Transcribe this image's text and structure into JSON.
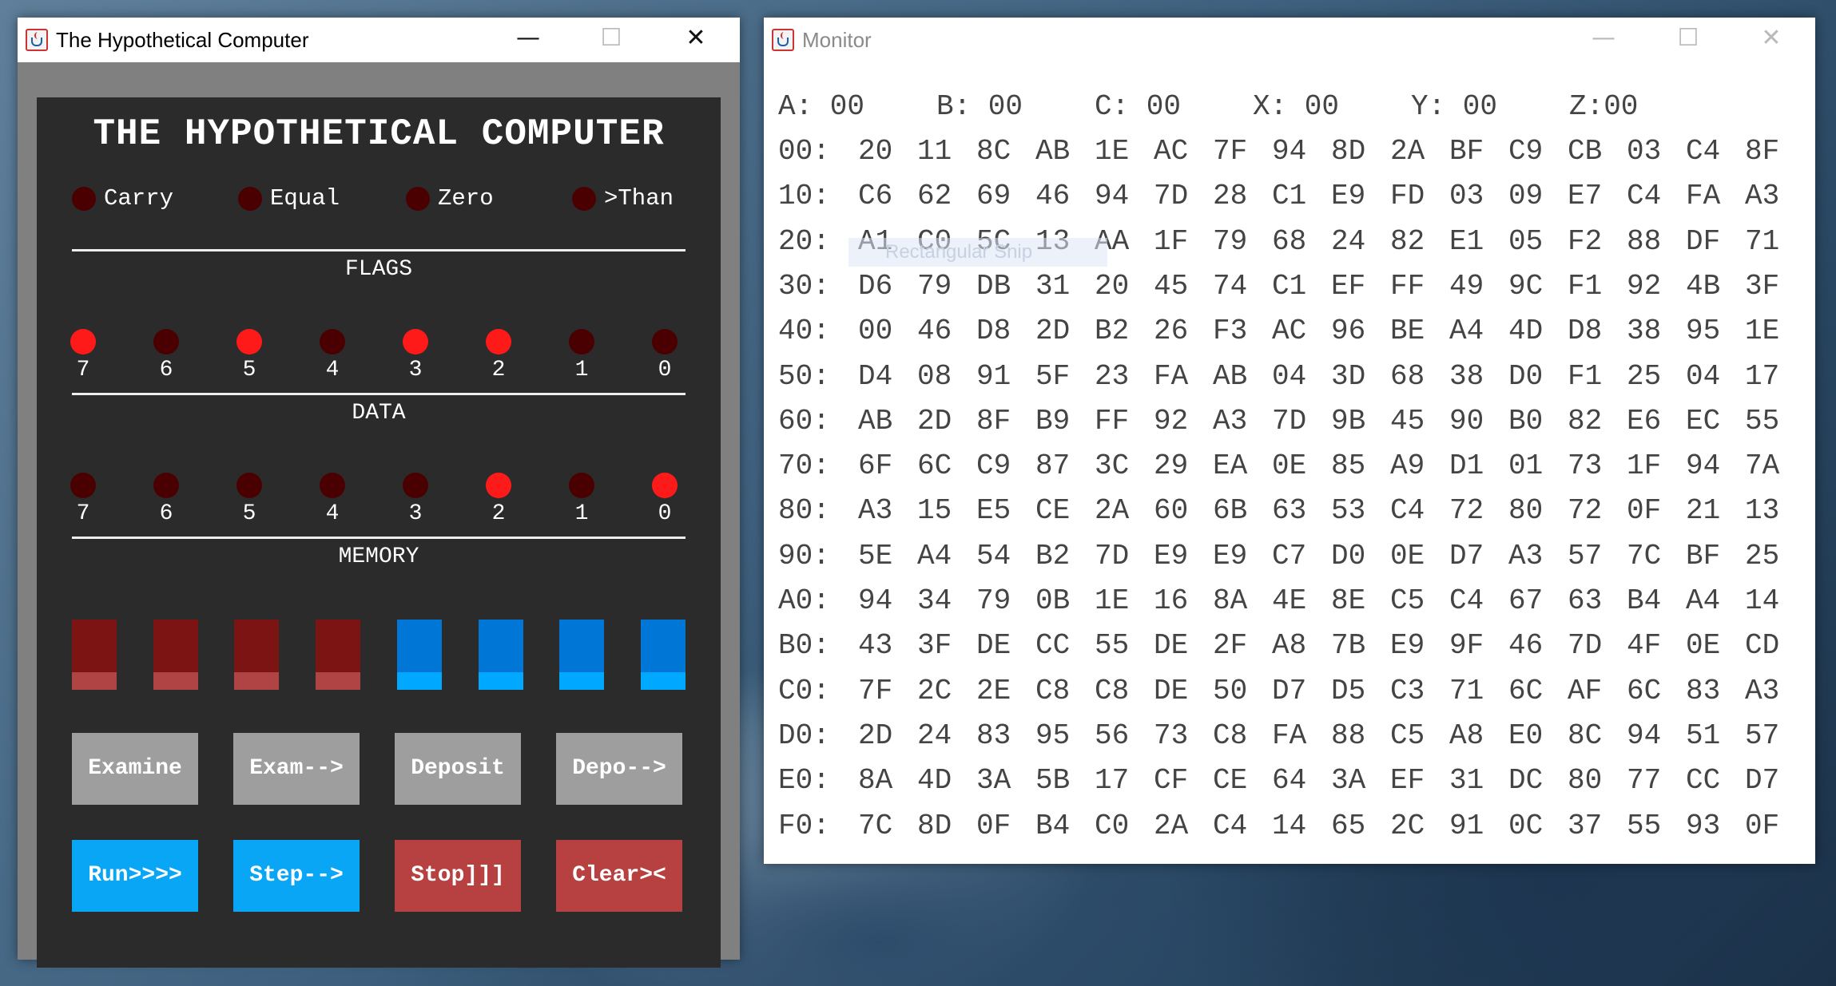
{
  "computer_window": {
    "title": "The Hypothetical Computer",
    "controls": {
      "minimize": "—",
      "maximize": "☐",
      "close": "✕"
    },
    "heading": "THE HYPOTHETICAL COMPUTER",
    "flags": {
      "section_label": "FLAGS",
      "items": [
        {
          "label": "Carry",
          "on": false
        },
        {
          "label": "Equal",
          "on": false
        },
        {
          "label": "Zero",
          "on": false
        },
        {
          "label": ">Than",
          "on": false
        }
      ]
    },
    "data": {
      "section_label": "DATA",
      "bits": [
        {
          "label": "7",
          "on": true
        },
        {
          "label": "6",
          "on": false
        },
        {
          "label": "5",
          "on": true
        },
        {
          "label": "4",
          "on": false
        },
        {
          "label": "3",
          "on": true
        },
        {
          "label": "2",
          "on": true
        },
        {
          "label": "1",
          "on": false
        },
        {
          "label": "0",
          "on": false
        }
      ]
    },
    "memory": {
      "section_label": "MEMORY",
      "bits": [
        {
          "label": "7",
          "on": false
        },
        {
          "label": "6",
          "on": false
        },
        {
          "label": "5",
          "on": false
        },
        {
          "label": "4",
          "on": false
        },
        {
          "label": "3",
          "on": false
        },
        {
          "label": "2",
          "on": true
        },
        {
          "label": "1",
          "on": false
        },
        {
          "label": "0",
          "on": true
        }
      ]
    },
    "switches": [
      "red",
      "red",
      "red",
      "red",
      "blue",
      "blue",
      "blue",
      "blue"
    ],
    "buttons_row1": [
      {
        "label": "Examine",
        "color": "#9e9e9e"
      },
      {
        "label": "Exam-->",
        "color": "#9e9e9e"
      },
      {
        "label": "Deposit",
        "color": "#9e9e9e"
      },
      {
        "label": "Depo-->",
        "color": "#9e9e9e"
      }
    ],
    "buttons_row2": [
      {
        "label": "Run>>>>",
        "color": "#09a6f5"
      },
      {
        "label": "Step-->",
        "color": "#09a6f5"
      },
      {
        "label": "Stop]]]",
        "color": "#b74141"
      },
      {
        "label": "Clear><",
        "color": "#b74141"
      }
    ]
  },
  "monitor_window": {
    "title": "Monitor",
    "controls": {
      "minimize": "—",
      "maximize": "☐",
      "close": "✕"
    },
    "registers": [
      "A: 00",
      "B: 00",
      "C: 00",
      "X: 00",
      "Y: 00",
      "Z:00"
    ],
    "rows": [
      {
        "addr": "00:",
        "cells": [
          "20",
          "11",
          "8C",
          "AB",
          "1E",
          "AC",
          "7F",
          "94",
          "8D",
          "2A",
          "BF",
          "C9",
          "CB",
          "03",
          "C4",
          "8F"
        ]
      },
      {
        "addr": "10:",
        "cells": [
          "C6",
          "62",
          "69",
          "46",
          "94",
          "7D",
          "28",
          "C1",
          "E9",
          "FD",
          "03",
          "09",
          "E7",
          "C4",
          "FA",
          "A3"
        ]
      },
      {
        "addr": "20:",
        "cells": [
          "A1",
          "C0",
          "5C",
          "13",
          "AA",
          "1F",
          "79",
          "68",
          "24",
          "82",
          "E1",
          "05",
          "F2",
          "88",
          "DF",
          "71"
        ]
      },
      {
        "addr": "30:",
        "cells": [
          "D6",
          "79",
          "DB",
          "31",
          "20",
          "45",
          "74",
          "C1",
          "EF",
          "FF",
          "49",
          "9C",
          "F1",
          "92",
          "4B",
          "3F"
        ]
      },
      {
        "addr": "40:",
        "cells": [
          "00",
          "46",
          "D8",
          "2D",
          "B2",
          "26",
          "F3",
          "AC",
          "96",
          "BE",
          "A4",
          "4D",
          "D8",
          "38",
          "95",
          "1E"
        ]
      },
      {
        "addr": "50:",
        "cells": [
          "D4",
          "08",
          "91",
          "5F",
          "23",
          "FA",
          "AB",
          "04",
          "3D",
          "68",
          "38",
          "D0",
          "F1",
          "25",
          "04",
          "17"
        ]
      },
      {
        "addr": "60:",
        "cells": [
          "AB",
          "2D",
          "8F",
          "B9",
          "FF",
          "92",
          "A3",
          "7D",
          "9B",
          "45",
          "90",
          "B0",
          "82",
          "E6",
          "EC",
          "55"
        ]
      },
      {
        "addr": "70:",
        "cells": [
          "6F",
          "6C",
          "C9",
          "87",
          "3C",
          "29",
          "EA",
          "0E",
          "85",
          "A9",
          "D1",
          "01",
          "73",
          "1F",
          "94",
          "7A"
        ]
      },
      {
        "addr": "80:",
        "cells": [
          "A3",
          "15",
          "E5",
          "CE",
          "2A",
          "60",
          "6B",
          "63",
          "53",
          "C4",
          "72",
          "80",
          "72",
          "0F",
          "21",
          "13"
        ]
      },
      {
        "addr": "90:",
        "cells": [
          "5E",
          "A4",
          "54",
          "B2",
          "7D",
          "E9",
          "E9",
          "C7",
          "D0",
          "0E",
          "D7",
          "A3",
          "57",
          "7C",
          "BF",
          "25"
        ]
      },
      {
        "addr": "A0:",
        "cells": [
          "94",
          "34",
          "79",
          "0B",
          "1E",
          "16",
          "8A",
          "4E",
          "8E",
          "C5",
          "C4",
          "67",
          "63",
          "B4",
          "A4",
          "14"
        ]
      },
      {
        "addr": "B0:",
        "cells": [
          "43",
          "3F",
          "DE",
          "CC",
          "55",
          "DE",
          "2F",
          "A8",
          "7B",
          "E9",
          "9F",
          "46",
          "7D",
          "4F",
          "0E",
          "CD"
        ]
      },
      {
        "addr": "C0:",
        "cells": [
          "7F",
          "2C",
          "2E",
          "C8",
          "C8",
          "DE",
          "50",
          "D7",
          "D5",
          "C3",
          "71",
          "6C",
          "AF",
          "6C",
          "83",
          "A3"
        ]
      },
      {
        "addr": "D0:",
        "cells": [
          "2D",
          "24",
          "83",
          "95",
          "56",
          "73",
          "C8",
          "FA",
          "88",
          "C5",
          "A8",
          "E0",
          "8C",
          "94",
          "51",
          "57"
        ]
      },
      {
        "addr": "E0:",
        "cells": [
          "8A",
          "4D",
          "3A",
          "5B",
          "17",
          "CF",
          "CE",
          "64",
          "3A",
          "EF",
          "31",
          "DC",
          "80",
          "77",
          "CC",
          "D7"
        ]
      },
      {
        "addr": "F0:",
        "cells": [
          "7C",
          "8D",
          "0F",
          "B4",
          "C0",
          "2A",
          "C4",
          "14",
          "65",
          "2C",
          "91",
          "0C",
          "37",
          "55",
          "93",
          "0F"
        ]
      }
    ]
  },
  "overlay": {
    "snip_text": "Rectangular Snip"
  }
}
